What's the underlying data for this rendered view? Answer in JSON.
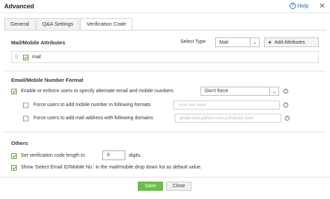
{
  "dialog": {
    "title": "Advanced",
    "help_label": "Help",
    "close_glyph": "✕"
  },
  "tabs": [
    {
      "label": "General",
      "active": false
    },
    {
      "label": "Q&A Settings",
      "active": false
    },
    {
      "label": "Verification Code",
      "active": true
    }
  ],
  "mail_mobile_attributes": {
    "title": "Mail/Mobile Attributes",
    "select_type_label": "Select Type",
    "select_type_value": "Mail",
    "add_attributes_label": "Add Attributes",
    "items": [
      {
        "label": "mail",
        "checked": true
      }
    ]
  },
  "number_format": {
    "title": "Email/Mobile Number Format",
    "enforce": {
      "label": "Enable or enforce users to specify alternate email and mobile numbers",
      "checked": true,
      "dropdown_value": "Don't force"
    },
    "mobile_format": {
      "label": "Force users to add mobile number in following formats",
      "checked": false,
      "placeholder": "+xxx xxx xxxx"
    },
    "mail_domain": {
      "label": "Force users to add mail address with following domains",
      "checked": false,
      "placeholder": "gmail.com,yahoo.com,zohocorp.com"
    }
  },
  "others": {
    "title": "Others",
    "code_length": {
      "label_before": "Set verification code length to",
      "value": "8",
      "label_after": "digits.",
      "checked": true
    },
    "show_select": {
      "label": "Show 'Select Email ID/Mobile No.' in the mail/mobile drop down list as default value.",
      "checked": true
    }
  },
  "footer": {
    "save_label": "Save",
    "close_label": "Close"
  },
  "colors": {
    "link": "#2a6fcf",
    "check": "#3c9a29",
    "save_button": "#6cc04a"
  }
}
